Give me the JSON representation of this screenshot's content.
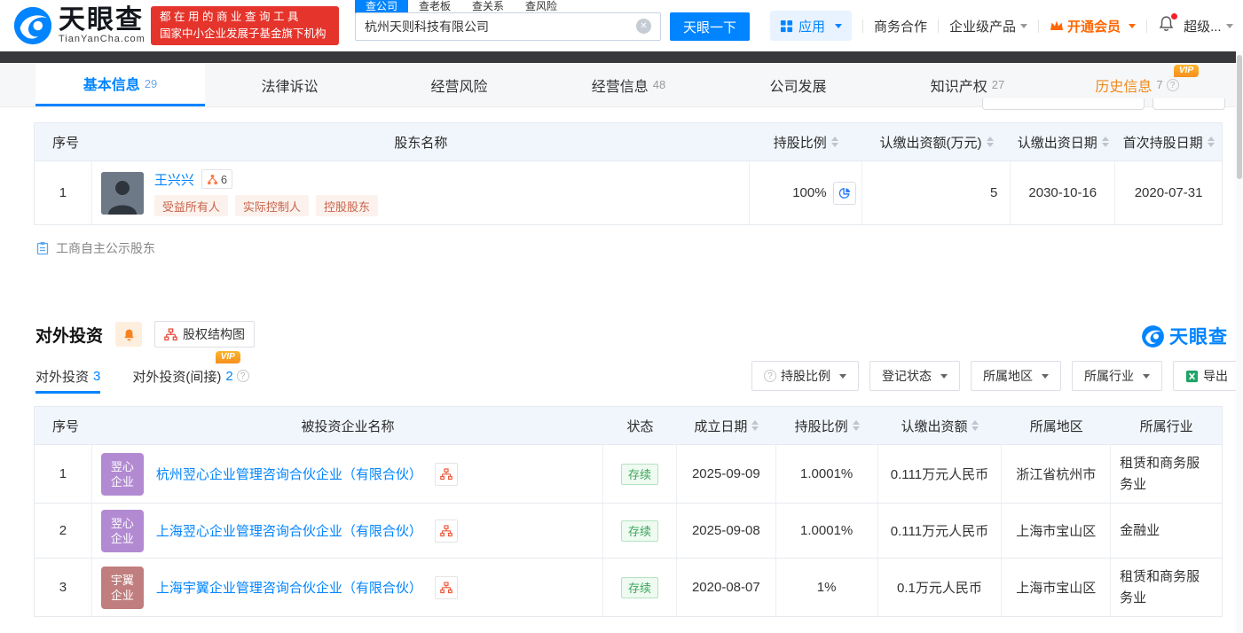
{
  "brand": {
    "name": "天眼查",
    "domain": "TianYanCha.com",
    "accent": "#0084ff"
  },
  "banner": {
    "line1": "都在用的商业查询工具",
    "line2": "国家中小企业发展子基金旗下机构",
    "bg": "#e5342b"
  },
  "search": {
    "tabs": [
      {
        "label": "查公司",
        "active": true
      },
      {
        "label": "查老板",
        "active": false
      },
      {
        "label": "查关系",
        "active": false
      },
      {
        "label": "查风险",
        "active": false
      }
    ],
    "value": "杭州天则科技有限公司",
    "button": "天眼一下"
  },
  "nav": {
    "apps": "应用",
    "cooperation": "商务合作",
    "enterprise": "企业级产品",
    "vip": "开通会员",
    "super": "超级..."
  },
  "misc": {
    "vip": "VIP"
  },
  "page_tabs": [
    {
      "label": "基本信息",
      "count": "29"
    },
    {
      "label": "法律诉讼",
      "count": ""
    },
    {
      "label": "经营风险",
      "count": ""
    },
    {
      "label": "经营信息",
      "count": "48"
    },
    {
      "label": "公司发展",
      "count": ""
    },
    {
      "label": "知识产权",
      "count": "27"
    },
    {
      "label": "历史信息",
      "count": "7"
    }
  ],
  "shareholders": {
    "columns": [
      "序号",
      "股东名称",
      "持股比例",
      "认缴出资额(万元)",
      "认缴出资日期",
      "首次持股日期"
    ],
    "row": {
      "index": "1",
      "name": "王兴兴",
      "relation_count": "6",
      "tags": [
        "受益所有人",
        "实际控制人",
        "控股股东"
      ],
      "ratio": "100%",
      "amount": "5",
      "subscribe_date": "2030-10-16",
      "first_hold_date": "2020-07-31"
    },
    "footer_link": "工商自主公示股东"
  },
  "investment": {
    "title": "对外投资",
    "structure_button": "股权结构图",
    "brand_mark": "天眼查",
    "tabs": [
      {
        "label": "对外投资",
        "count": "3"
      },
      {
        "label": "对外投资(间接)",
        "count": "2"
      }
    ],
    "filters": [
      "持股比例",
      "登记状态",
      "所属地区",
      "所属行业"
    ],
    "export_label": "导出",
    "columns": [
      "序号",
      "被投资企业名称",
      "状态",
      "成立日期",
      "持股比例",
      "认缴出资额",
      "所属地区",
      "所属行业"
    ],
    "status_color": "#3aa65a",
    "rows": [
      {
        "index": "1",
        "avatar": "翌心企业",
        "avatar_color": "#b28ad2",
        "name": "杭州翌心企业管理咨询合伙企业（有限合伙）",
        "status": "存续",
        "date": "2025-09-09",
        "ratio": "1.0001%",
        "amount": "0.111万元人民币",
        "region": "浙江省杭州市",
        "industry": "租赁和商务服务业"
      },
      {
        "index": "2",
        "avatar": "翌心企业",
        "avatar_color": "#b28ad2",
        "name": "上海翌心企业管理咨询合伙企业（有限合伙）",
        "status": "存续",
        "date": "2025-09-08",
        "ratio": "1.0001%",
        "amount": "0.111万元人民币",
        "region": "上海市宝山区",
        "industry": "金融业"
      },
      {
        "index": "3",
        "avatar": "宇翼企业",
        "avatar_color": "#c07e7e",
        "name": "上海宇翼企业管理咨询合伙企业（有限合伙）",
        "status": "存续",
        "date": "2020-08-07",
        "ratio": "1%",
        "amount": "0.1万元人民币",
        "region": "上海市宝山区",
        "industry": "租赁和商务服务业"
      }
    ]
  },
  "icons": {
    "logo": "tianyancha-swirl",
    "apps": "grid",
    "vip": "crown",
    "bell": "bell",
    "clear": "circle-x",
    "pie": "pie-chart",
    "relation": "network",
    "clipboard": "clipboard",
    "org": "org-chart",
    "excel": "excel-file",
    "help": "question-circle",
    "sort": "sort-arrows",
    "caret": "caret-down"
  }
}
